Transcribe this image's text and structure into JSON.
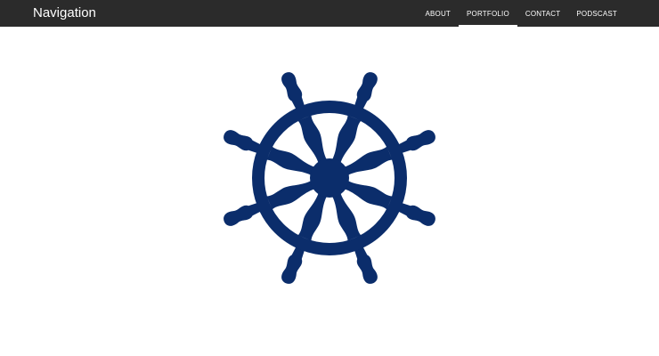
{
  "navbar": {
    "brand": "Navigation",
    "links": [
      {
        "label": "ABOUT"
      },
      {
        "label": "PORTFOLIO",
        "active": true
      },
      {
        "label": "CONTACT"
      },
      {
        "label": "PODSCAST"
      }
    ]
  },
  "hero": {
    "icon": "ship-wheel-icon",
    "icon_color": "#0b2d6b"
  },
  "colors": {
    "navbar_bg": "#2b2b2b",
    "nav_text": "#ffffff",
    "page_bg": "#ffffff"
  }
}
